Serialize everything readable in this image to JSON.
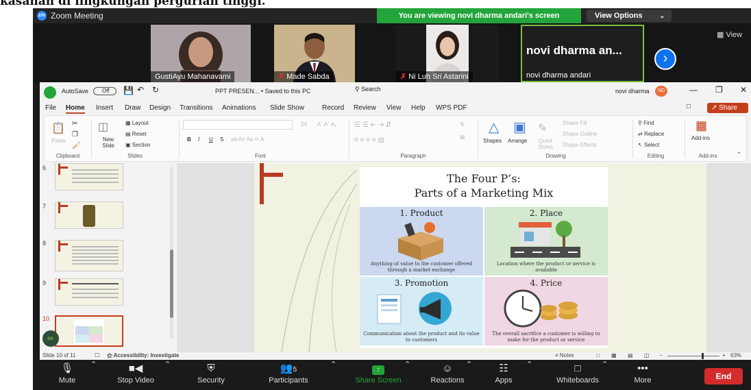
{
  "caption": "kasahan di lingkungan pergurian tinggi.",
  "zoom": {
    "title": "Zoom Meeting",
    "viewing_banner": "You are viewing novi dharma andari's screen",
    "view_options": "View Options",
    "view_button": "View",
    "participants_strip": [
      {
        "name": "GustiAyu Mahanavami",
        "muted": false
      },
      {
        "name": "Made Sabda",
        "muted": true
      },
      {
        "name": "Ni Luh Sri Astarini",
        "muted": true
      },
      {
        "name": "novi dharma andari",
        "display": "novi dharma an...",
        "muted": false
      }
    ],
    "toolbar": {
      "mute": "Mute",
      "stop_video": "Stop Video",
      "security": "Security",
      "participants": "Participants",
      "participants_count": "5",
      "share_screen": "Share Screen",
      "reactions": "Reactions",
      "apps": "Apps",
      "whiteboards": "Whiteboards",
      "more": "More",
      "end": "End"
    }
  },
  "ppt": {
    "autosave": "AutoSave",
    "autosave_state": "Off",
    "filename": "PPT PRESEN... • Saved to this PC",
    "search": "Search",
    "user": "novi dharma",
    "user_initials": "ND",
    "share": "Share",
    "tabs": [
      "File",
      "Home",
      "Insert",
      "Draw",
      "Design",
      "Transitions",
      "Animations",
      "Slide Show",
      "Record",
      "Review",
      "View",
      "Help",
      "WPS PDF"
    ],
    "active_tab": "Home",
    "ribbon": {
      "clipboard": {
        "paste": "Paste",
        "label": "Clipboard"
      },
      "slides": {
        "new_slide": "New Slide",
        "layout": "Layout",
        "reset": "Reset",
        "section": "Section",
        "label": "Slides"
      },
      "font": {
        "label": "Font",
        "size": "24"
      },
      "paragraph": {
        "label": "Paragraph"
      },
      "drawing": {
        "shapes": "Shapes",
        "arrange": "Arrange",
        "quick_styles": "Quick Styles",
        "shape_fill": "Shape Fill",
        "shape_outline": "Shape Outline",
        "shape_effects": "Shape Effects",
        "label": "Drawing"
      },
      "editing": {
        "find": "Find",
        "replace": "Replace",
        "select": "Select",
        "label": "Editing"
      },
      "addins": {
        "button": "Add-ins",
        "label": "Add-ins"
      }
    },
    "thumbnails": [
      "6",
      "7",
      "8",
      "9",
      "10"
    ],
    "current_slide": "10",
    "slide": {
      "title_line1": "The Four P’s:",
      "title_line2": "Parts of a Marketing Mix",
      "quadrants": [
        {
          "title": "1. Product",
          "desc": "Anything of value to the customer offered through a market exchange",
          "color": "#cbd8ef"
        },
        {
          "title": "2. Place",
          "desc": "Location where the product or service is available",
          "color": "#d4e9cf"
        },
        {
          "title": "3. Promotion",
          "desc": "Communication about the product and its value to customers",
          "color": "#d5ebf5"
        },
        {
          "title": "4. Price",
          "desc": "The overall sacrifice a customer is willing to make for the product or service",
          "color": "#f1d6e3"
        }
      ]
    },
    "status": {
      "slide_count": "Slide 10 of 11",
      "accessibility": "Accessibility: Investigate",
      "notes": "Notes",
      "zoom": "63%"
    }
  }
}
